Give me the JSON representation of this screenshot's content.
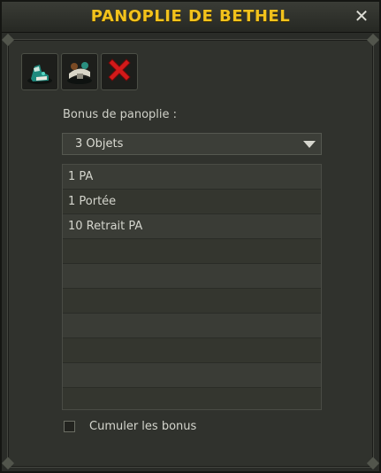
{
  "window": {
    "title": "PANOPLIE DE BETHEL"
  },
  "items": [
    {
      "icon": "boots-icon"
    },
    {
      "icon": "belt-icon"
    },
    {
      "icon": "remove-icon"
    }
  ],
  "bonus": {
    "label": "Bonus de panoplie :",
    "selected": "3 Objets",
    "rows": [
      "1 PA",
      "1 Portée",
      "10 Retrait PA",
      "",
      "",
      "",
      "",
      "",
      "",
      ""
    ]
  },
  "option": {
    "cumulate_label": "Cumuler les bonus",
    "checked": false
  },
  "colors": {
    "title": "#f2c21c",
    "remove": "#d21a1a"
  }
}
